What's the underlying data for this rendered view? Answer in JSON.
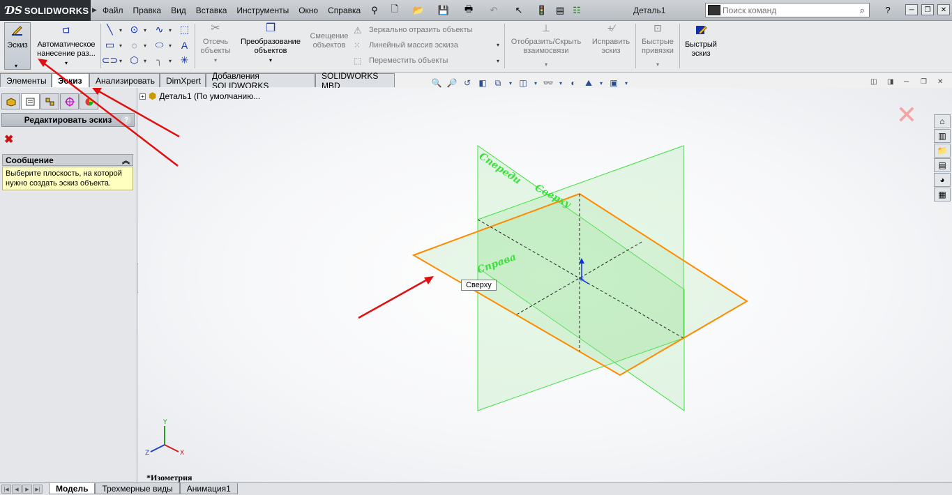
{
  "titlebar": {
    "brand": "SOLIDWORKS",
    "brand_prefix": "DS",
    "menu": [
      "Файл",
      "Правка",
      "Вид",
      "Вставка",
      "Инструменты",
      "Окно",
      "Справка"
    ],
    "document_title": "Деталь1",
    "search_placeholder": "Поиск команд"
  },
  "ribbon": {
    "sketch": "Эскиз",
    "auto_dim_line1": "Автоматическое",
    "auto_dim_line2": "нанесение раз...",
    "trim_line1": "Отсечь",
    "trim_line2": "объекты",
    "convert_line1": "Преобразование",
    "convert_line2": "объектов",
    "offset_line1": "Смещение",
    "offset_line2": "объектов",
    "mirror": "Зеркально отразить объекты",
    "linear_pattern": "Линейный массив эскиза",
    "move": "Переместить объекты",
    "relations_line1": "Отобразить/Скрыть",
    "relations_line2": "взаимосвязи",
    "repair_line1": "Исправить",
    "repair_line2": "эскиз",
    "snaps_line1": "Быстрые",
    "snaps_line2": "привязки",
    "rapid_line1": "Быстрый",
    "rapid_line2": "эскиз"
  },
  "tabs": [
    "Элементы",
    "Эскиз",
    "Анализировать",
    "DimXpert",
    "Добавления SOLIDWORKS",
    "SOLIDWORKS MBD"
  ],
  "active_tab": "Эскиз",
  "property_manager": {
    "title": "Редактировать эскиз",
    "message_header": "Сообщение",
    "message_text": "Выберите плоскость, на которой нужно создать эскиз объекта."
  },
  "viewport": {
    "tree_item": "Деталь1  (По умолчанию...",
    "plane_front": "Спереди",
    "plane_top": "Сверху",
    "plane_right": "Справа",
    "tooltip": "Сверху",
    "view_label": "*Изометрия",
    "axis_x": "X",
    "axis_y": "Y",
    "axis_z": "Z"
  },
  "bottom_tabs": [
    "Модель",
    "Трехмерные виды",
    "Анимация1"
  ],
  "active_bottom_tab": "Модель",
  "colors": {
    "plane_green": "#3ee03e",
    "plane_orange": "#ff8a00",
    "annotation_red": "#e01010",
    "message_yellow": "#ffffc0"
  }
}
